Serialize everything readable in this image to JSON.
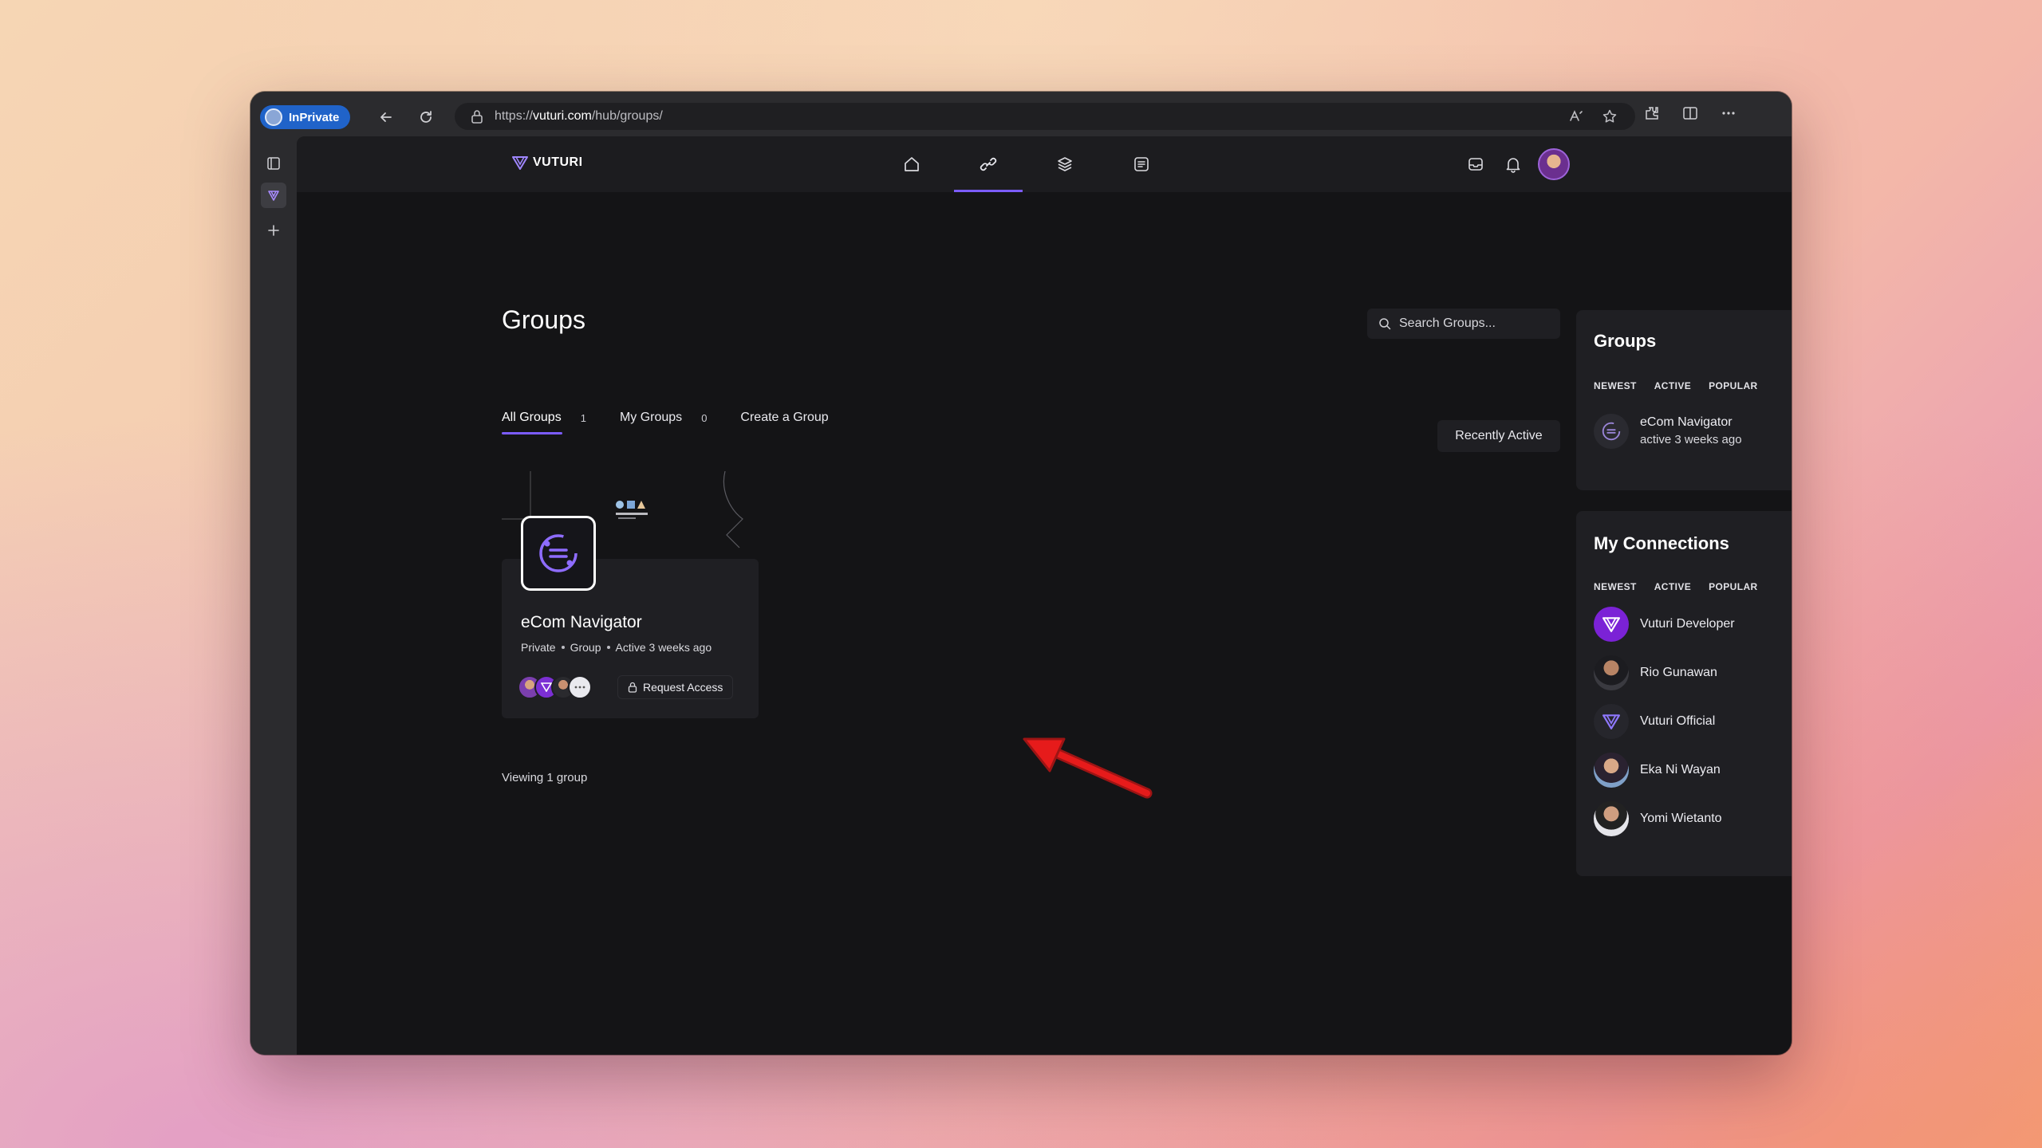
{
  "browser": {
    "inprivate_label": "InPrivate",
    "url_prefix": "https://",
    "url_host": "vuturi.com",
    "url_path": "/hub/groups/"
  },
  "site": {
    "logo_text": "VUTURI",
    "accent_color": "#7c5cff",
    "nav_icons": [
      "home-icon",
      "link-icon",
      "layers-icon",
      "document-icon"
    ]
  },
  "page": {
    "title": "Groups",
    "tabs": [
      {
        "label": "All Groups",
        "count": "1"
      },
      {
        "label": "My Groups",
        "count": "0"
      },
      {
        "label": "Create a Group",
        "count": ""
      }
    ],
    "search_placeholder": "Search Groups...",
    "sort_label": "Recently Active",
    "viewing_text": "Viewing 1 group"
  },
  "group_card": {
    "name": "eCom Navigator",
    "meta": [
      "Private",
      "Group",
      "Active 3 weeks ago"
    ],
    "request_label": "Request Access"
  },
  "groups_widget": {
    "title": "Groups",
    "tabs": [
      "NEWEST",
      "ACTIVE",
      "POPULAR"
    ],
    "items": [
      {
        "name": "eCom Navigator",
        "activity": "active 3 weeks ago"
      }
    ]
  },
  "connections_widget": {
    "title": "My Connections",
    "tabs": [
      "NEWEST",
      "ACTIVE",
      "POPULAR"
    ],
    "items": [
      {
        "name": "Vuturi Developer"
      },
      {
        "name": "Rio Gunawan"
      },
      {
        "name": "Vuturi Official"
      },
      {
        "name": "Eka Ni Wayan"
      },
      {
        "name": "Yomi Wietanto"
      }
    ]
  }
}
